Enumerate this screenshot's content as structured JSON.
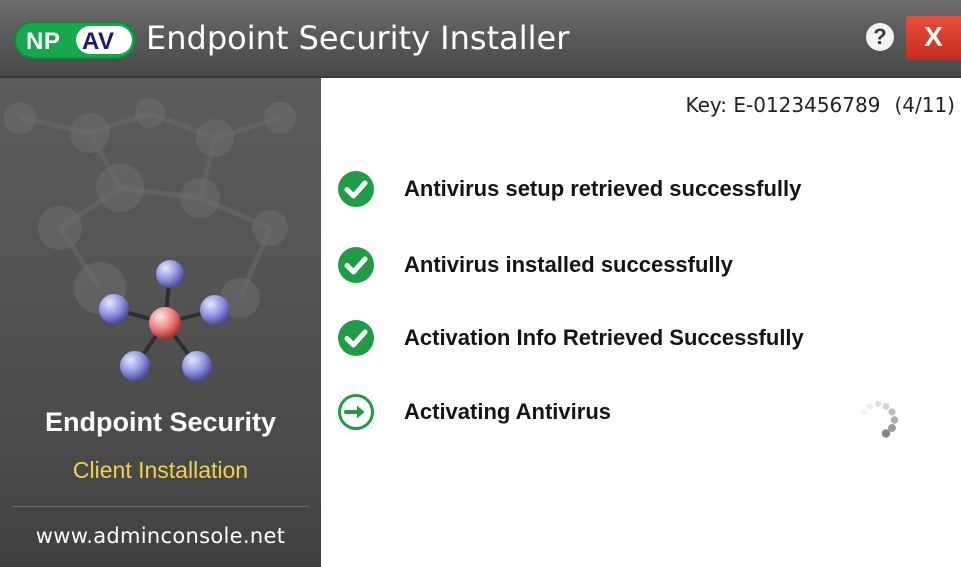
{
  "window": {
    "logo": {
      "np": "NP",
      "av": "AV"
    },
    "title": "Endpoint Security Installer",
    "help_label": "?",
    "close_label": "X"
  },
  "sidebar": {
    "product_title": "Endpoint Security",
    "subtitle": "Client Installation",
    "url": "www.adminconsole.net"
  },
  "main": {
    "key_label": "Key:",
    "key_value": "E-0123456789",
    "step_counter": "(4/11)",
    "steps": [
      {
        "label": "Antivirus setup retrieved successfully",
        "status": "done",
        "icon": "check-circle-icon"
      },
      {
        "label": "Antivirus installed successfully",
        "status": "done",
        "icon": "check-circle-icon"
      },
      {
        "label": "Activation Info Retrieved Successfully",
        "status": "done",
        "icon": "check-circle-icon"
      },
      {
        "label": "Activating Antivirus",
        "status": "in-progress",
        "icon": "arrow-right-circle-icon"
      }
    ]
  },
  "colors": {
    "accent_green": "#1f9c45",
    "subtitle_yellow": "#f0d24a",
    "close_red": "#d63a26"
  }
}
